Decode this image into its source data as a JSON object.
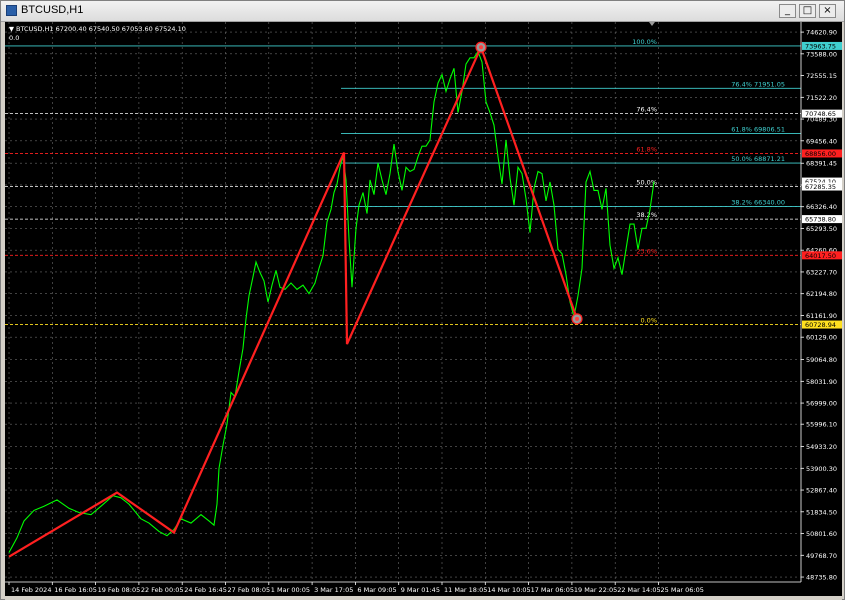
{
  "window": {
    "title": "BTCUSD,H1",
    "min_label": "_",
    "max_label": "□",
    "close_label": "×",
    "icon": "chart-window-icon"
  },
  "chart_header": {
    "info": "BTCUSD,H1  67200.40 67540.50 67053.60 67524.10",
    "zero_label": "0.0"
  },
  "chart_data": {
    "type": "line",
    "price_axis_labels": [
      "74620.90",
      "73588.00",
      "72555.15",
      "71522.20",
      "70489.30",
      "69456.40",
      "68391.45",
      "67358.55",
      "66326.40",
      "65293.50",
      "64260.60",
      "63227.70",
      "62194.80",
      "61161.90",
      "60129.00",
      "59064.80",
      "58031.90",
      "56999.00",
      "55996.10",
      "54933.20",
      "53900.30",
      "52867.40",
      "51834.50",
      "50801.60",
      "49768.70",
      "48735.80"
    ],
    "price_axis_ticks": [
      74620.9,
      73588.0,
      72555.15,
      71522.2,
      70489.3,
      69456.4,
      68391.45,
      67358.55,
      66326.4,
      65293.5,
      64260.6,
      63227.7,
      62194.8,
      61161.9,
      60129.0,
      59064.8,
      58031.9,
      56999.0,
      55996.1,
      54933.2,
      53900.3,
      52867.4,
      51834.5,
      50801.6,
      49768.7,
      48735.8
    ],
    "ylim": [
      48500,
      75100
    ],
    "time_axis_labels": [
      "14 Feb 2024",
      "16 Feb 16:05",
      "19 Feb 08:05",
      "22 Feb 00:05",
      "24 Feb 16:45",
      "27 Feb 08:05",
      "1 Mar 00:05",
      "3 Mar 17:05",
      "6 Mar 09:05",
      "9 Mar 01:45",
      "11 Mar 18:05",
      "14 Mar 10:05",
      "17 Mar 06:05",
      "19 Mar 22:05",
      "22 Mar 14:05",
      "25 Mar 06:05"
    ],
    "price_path": [
      [
        0,
        49900
      ],
      [
        8,
        50600
      ],
      [
        15,
        51400
      ],
      [
        25,
        51900
      ],
      [
        35,
        52100
      ],
      [
        48,
        52400
      ],
      [
        60,
        52000
      ],
      [
        70,
        51800
      ],
      [
        82,
        51700
      ],
      [
        92,
        52100
      ],
      [
        104,
        52600
      ],
      [
        112,
        52500
      ],
      [
        120,
        52200
      ],
      [
        132,
        51500
      ],
      [
        140,
        51300
      ],
      [
        150,
        50900
      ],
      [
        158,
        50700
      ],
      [
        165,
        51000
      ],
      [
        172,
        51500
      ],
      [
        182,
        51300
      ],
      [
        192,
        51700
      ],
      [
        200,
        51400
      ],
      [
        205,
        51200
      ],
      [
        208,
        52200
      ],
      [
        210,
        53900
      ],
      [
        214,
        55000
      ],
      [
        218,
        56000
      ],
      [
        222,
        57500
      ],
      [
        226,
        57300
      ],
      [
        230,
        58500
      ],
      [
        234,
        59600
      ],
      [
        237,
        61000
      ],
      [
        240,
        62100
      ],
      [
        244,
        63000
      ],
      [
        247,
        63700
      ],
      [
        251,
        63200
      ],
      [
        255,
        62800
      ],
      [
        259,
        61800
      ],
      [
        263,
        62600
      ],
      [
        267,
        63300
      ],
      [
        271,
        62500
      ],
      [
        276,
        62400
      ],
      [
        282,
        62700
      ],
      [
        288,
        62400
      ],
      [
        294,
        62600
      ],
      [
        300,
        62200
      ],
      [
        306,
        62700
      ],
      [
        310,
        63400
      ],
      [
        314,
        64000
      ],
      [
        318,
        65600
      ],
      [
        322,
        66200
      ],
      [
        325,
        67000
      ],
      [
        328,
        67400
      ],
      [
        331,
        68200
      ],
      [
        334,
        68700
      ],
      [
        337,
        67600
      ],
      [
        340,
        64800
      ],
      [
        343,
        62500
      ],
      [
        347,
        65300
      ],
      [
        350,
        66400
      ],
      [
        354,
        67000
      ],
      [
        358,
        66000
      ],
      [
        361,
        67600
      ],
      [
        365,
        66900
      ],
      [
        369,
        68400
      ],
      [
        373,
        67600
      ],
      [
        377,
        66900
      ],
      [
        381,
        67900
      ],
      [
        385,
        69300
      ],
      [
        389,
        68000
      ],
      [
        393,
        67100
      ],
      [
        397,
        68200
      ],
      [
        401,
        68000
      ],
      [
        405,
        68100
      ],
      [
        409,
        68700
      ],
      [
        413,
        69200
      ],
      [
        417,
        69200
      ],
      [
        421,
        69500
      ],
      [
        425,
        71300
      ],
      [
        429,
        72200
      ],
      [
        433,
        72600
      ],
      [
        437,
        71800
      ],
      [
        441,
        72400
      ],
      [
        445,
        72900
      ],
      [
        449,
        70800
      ],
      [
        453,
        71800
      ],
      [
        457,
        73100
      ],
      [
        461,
        73400
      ],
      [
        465,
        73400
      ],
      [
        469,
        73700
      ],
      [
        473,
        73200
      ],
      [
        477,
        71300
      ],
      [
        481,
        70800
      ],
      [
        485,
        70200
      ],
      [
        489,
        68700
      ],
      [
        493,
        67400
      ],
      [
        497,
        69500
      ],
      [
        501,
        67700
      ],
      [
        505,
        66400
      ],
      [
        509,
        68200
      ],
      [
        513,
        67900
      ],
      [
        517,
        66700
      ],
      [
        521,
        65100
      ],
      [
        525,
        67200
      ],
      [
        529,
        68000
      ],
      [
        533,
        67900
      ],
      [
        537,
        66600
      ],
      [
        541,
        67500
      ],
      [
        545,
        66400
      ],
      [
        549,
        64300
      ],
      [
        553,
        64100
      ],
      [
        557,
        63100
      ],
      [
        561,
        61800
      ],
      [
        565,
        61100
      ],
      [
        569,
        62100
      ],
      [
        573,
        63400
      ],
      [
        577,
        67500
      ],
      [
        581,
        68000
      ],
      [
        585,
        67100
      ],
      [
        589,
        67100
      ],
      [
        593,
        66200
      ],
      [
        597,
        67200
      ],
      [
        601,
        64500
      ],
      [
        605,
        63400
      ],
      [
        609,
        63900
      ],
      [
        613,
        63100
      ],
      [
        617,
        64300
      ],
      [
        621,
        65500
      ],
      [
        625,
        65500
      ],
      [
        629,
        64300
      ],
      [
        633,
        65300
      ],
      [
        637,
        65300
      ],
      [
        641,
        66200
      ],
      [
        645,
        67520
      ]
    ],
    "zigzag_path": [
      [
        0,
        49700
      ],
      [
        108,
        52750
      ],
      [
        165,
        50850
      ],
      [
        335,
        68900
      ],
      [
        338,
        59800
      ],
      [
        472,
        73900
      ],
      [
        568,
        61000
      ]
    ],
    "pivot_markers": [
      [
        472,
        73900
      ],
      [
        568,
        61000
      ]
    ],
    "fibo_levels": [
      {
        "label": "100.0%",
        "price": 73963,
        "color": "#40d0d0"
      },
      {
        "label": "76.4% 71951.05",
        "price": 71951,
        "color": "#40d0d0"
      },
      {
        "label": "76.4%",
        "price": 70747,
        "color": "#ffffff"
      },
      {
        "label": "61.8% 69806.51",
        "price": 69807,
        "color": "#40d0d0"
      },
      {
        "label": "61.8%",
        "price": 68856,
        "color": "#ff2020"
      },
      {
        "label": "50.0% 68871.21",
        "price": 68400,
        "color": "#40d0d0"
      },
      {
        "label": "50.0%",
        "price": 67285,
        "color": "#ffffff"
      },
      {
        "label": "38.2% 66340.00",
        "price": 66340,
        "color": "#40d0d0"
      },
      {
        "label": "38.2%",
        "price": 65738,
        "color": "#ffffff"
      },
      {
        "label": "23.6%",
        "price": 64017,
        "color": "#ff2020"
      },
      {
        "label": "0.0%",
        "price": 60729,
        "color": "#ffe020"
      }
    ],
    "price_tags": [
      {
        "label": "73963.75",
        "price": 73963,
        "bg": "#40d0d0",
        "fg": "#000000"
      },
      {
        "label": "70748.65",
        "price": 70747,
        "bg": "#ffffff",
        "fg": "#000000"
      },
      {
        "label": "68856.00",
        "price": 68856,
        "bg": "#ff2020",
        "fg": "#000000"
      },
      {
        "label": "67524.10",
        "price": 67520,
        "bg": "#ffffff",
        "fg": "#000000"
      },
      {
        "label": "67285.35",
        "price": 67285,
        "bg": "#ffffff",
        "fg": "#000000"
      },
      {
        "label": "65738.80",
        "price": 65738,
        "bg": "#ffffff",
        "fg": "#000000"
      },
      {
        "label": "64017.50",
        "price": 64017,
        "bg": "#ff2020",
        "fg": "#000000"
      },
      {
        "label": "60728.94",
        "price": 60729,
        "bg": "#ffe020",
        "fg": "#000000"
      }
    ],
    "grid": true,
    "colors": {
      "price": "#00ff00",
      "zigzag": "#ff2020",
      "grid": "#6a6a6a",
      "axis_text": "#ffffff",
      "background": "#000000"
    }
  }
}
